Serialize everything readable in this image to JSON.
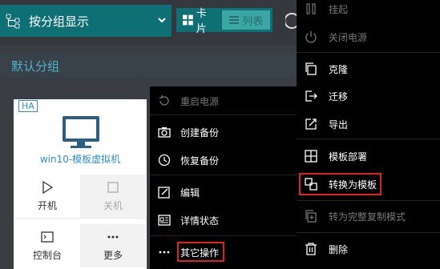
{
  "toolbar": {
    "group_display_label": "按分组显示",
    "card_label": "卡片",
    "list_label": "列表"
  },
  "group": {
    "title": "默认分组"
  },
  "vm": {
    "badge": "HA",
    "name": "win10-模板虚拟机",
    "actions": {
      "start": "开机",
      "shutdown": "关机",
      "console": "控制台",
      "more": "更多"
    }
  },
  "menu_mid": {
    "restart_power": "重启电源",
    "create_backup": "创建备份",
    "restore_backup": "恢复备份",
    "edit": "编辑",
    "detail_status": "详情状态",
    "other_ops": "其它操作"
  },
  "menu_right": {
    "suspend": "挂起",
    "power_off": "关闭电源",
    "clone": "克隆",
    "migrate": "迁移",
    "export": "导出",
    "template_deploy": "模板部署",
    "convert_template": "转换为模板",
    "convert_full_copy": "转为完整复制模式",
    "delete": "删除"
  },
  "colors": {
    "accent": "#0e6f74",
    "highlight_border": "#e0201f",
    "link_blue": "#2e8fd6"
  }
}
